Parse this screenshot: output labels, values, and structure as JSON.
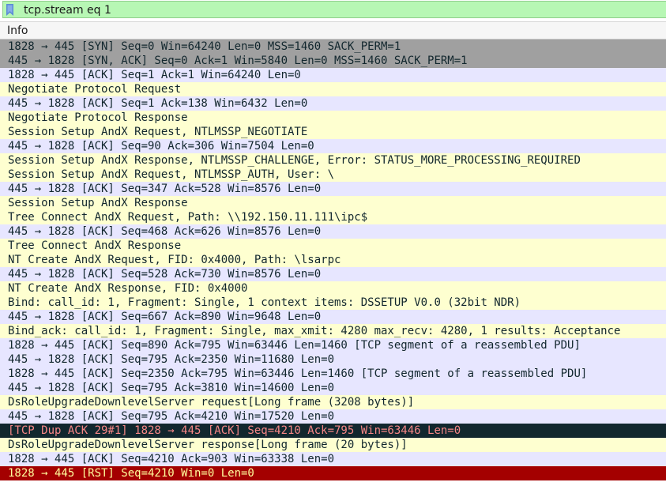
{
  "filter": {
    "value": "tcp.stream eq 1",
    "icon": "bookmark-icon"
  },
  "columns": [
    "Info"
  ],
  "rows": [
    {
      "info": "1828 → 445 [SYN] Seq=0 Win=64240 Len=0 MSS=1460 SACK_PERM=1",
      "style": "syn"
    },
    {
      "info": "445 → 1828 [SYN, ACK] Seq=0 Ack=1 Win=5840 Len=0 MSS=1460 SACK_PERM=1",
      "style": "syn"
    },
    {
      "info": "1828 → 445 [ACK] Seq=1 Ack=1 Win=64240 Len=0",
      "style": "tcp"
    },
    {
      "info": "Negotiate Protocol Request",
      "style": "smb"
    },
    {
      "info": "445 → 1828 [ACK] Seq=1 Ack=138 Win=6432 Len=0",
      "style": "tcp"
    },
    {
      "info": "Negotiate Protocol Response",
      "style": "smb"
    },
    {
      "info": "Session Setup AndX Request, NTLMSSP_NEGOTIATE",
      "style": "smb"
    },
    {
      "info": "445 → 1828 [ACK] Seq=90 Ack=306 Win=7504 Len=0",
      "style": "tcp"
    },
    {
      "info": "Session Setup AndX Response, NTLMSSP_CHALLENGE, Error: STATUS_MORE_PROCESSING_REQUIRED",
      "style": "smb"
    },
    {
      "info": "Session Setup AndX Request, NTLMSSP_AUTH, User: \\",
      "style": "smb"
    },
    {
      "info": "445 → 1828 [ACK] Seq=347 Ack=528 Win=8576 Len=0",
      "style": "tcp"
    },
    {
      "info": "Session Setup AndX Response",
      "style": "smb"
    },
    {
      "info": "Tree Connect AndX Request, Path: \\\\192.150.11.111\\ipc$",
      "style": "smb"
    },
    {
      "info": "445 → 1828 [ACK] Seq=468 Ack=626 Win=8576 Len=0",
      "style": "tcp"
    },
    {
      "info": "Tree Connect AndX Response",
      "style": "smb"
    },
    {
      "info": "NT Create AndX Request, FID: 0x4000, Path: \\lsarpc",
      "style": "smb"
    },
    {
      "info": "445 → 1828 [ACK] Seq=528 Ack=730 Win=8576 Len=0",
      "style": "tcp"
    },
    {
      "info": "NT Create AndX Response, FID: 0x4000",
      "style": "smb"
    },
    {
      "info": "Bind: call_id: 1, Fragment: Single, 1 context items: DSSETUP V0.0 (32bit NDR)",
      "style": "smb"
    },
    {
      "info": "445 → 1828 [ACK] Seq=667 Ack=890 Win=9648 Len=0",
      "style": "tcp"
    },
    {
      "info": "Bind_ack: call_id: 1, Fragment: Single, max_xmit: 4280 max_recv: 4280, 1 results: Acceptance",
      "style": "smb"
    },
    {
      "info": "1828 → 445 [ACK] Seq=890 Ack=795 Win=63446 Len=1460 [TCP segment of a reassembled PDU]",
      "style": "tcp"
    },
    {
      "info": "445 → 1828 [ACK] Seq=795 Ack=2350 Win=11680 Len=0",
      "style": "tcp"
    },
    {
      "info": "1828 → 445 [ACK] Seq=2350 Ack=795 Win=63446 Len=1460 [TCP segment of a reassembled PDU]",
      "style": "tcp"
    },
    {
      "info": "445 → 1828 [ACK] Seq=795 Ack=3810 Win=14600 Len=0",
      "style": "tcp"
    },
    {
      "info": "DsRoleUpgradeDownlevelServer request[Long frame (3208 bytes)]",
      "style": "smb"
    },
    {
      "info": "445 → 1828 [ACK] Seq=795 Ack=4210 Win=17520 Len=0",
      "style": "tcp"
    },
    {
      "info": "[TCP Dup ACK 29#1] 1828 → 445 [ACK] Seq=4210 Ack=795 Win=63446 Len=0",
      "style": "bad"
    },
    {
      "info": "DsRoleUpgradeDownlevelServer response[Long frame (20 bytes)]",
      "style": "smb"
    },
    {
      "info": "1828 → 445 [ACK] Seq=4210 Ack=903 Win=63338 Len=0",
      "style": "tcp"
    },
    {
      "info": "1828 → 445 [RST] Seq=4210 Win=0 Len=0",
      "style": "rst"
    }
  ],
  "colors": {
    "filter_valid": "#b7f7b4",
    "tcp_row": "#e7e6ff",
    "smb_row": "#feffd0",
    "syn_row": "#a0a0a0",
    "bad_tcp_row": "#12272e",
    "bad_tcp_text": "#f78787",
    "rst_row": "#a40000",
    "rst_text": "#fffc9c"
  }
}
